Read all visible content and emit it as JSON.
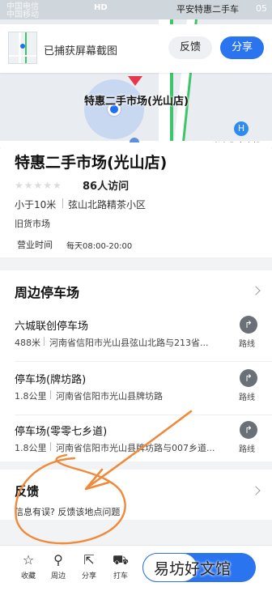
{
  "status_bar": {
    "carrier_line1": "中国电信",
    "carrier_line2": "中国移动",
    "center_text": "HD",
    "time": "05",
    "window_title": "平安特惠二手车"
  },
  "capture": {
    "text": "已捕获屏幕截图",
    "feedback_label": "反馈",
    "share_label": "分享"
  },
  "map": {
    "poi_label": "特惠二手市场(光山店)",
    "hospital_icon": "H",
    "side_label": "光山华康农机"
  },
  "poi": {
    "name": "特惠二手市场(光山店)",
    "stars_icon": "★★★★★",
    "stars_value": 0,
    "visits": "86人访问",
    "distance": "小于10米",
    "address": "弦山北路精茶小区",
    "category": "旧货市场",
    "hours_label": "营业时间",
    "hours": "每天08:00-20:00"
  },
  "parking": {
    "title": "周边停车场",
    "route_label": "路线",
    "items": [
      {
        "name": "六城联创停车场",
        "distance": "488米",
        "address": "河南省信阳市光山县弦山北路与213省..."
      },
      {
        "name": "停车场(牌坊路)",
        "distance": "1.8公里",
        "address": "河南省信阳市光山县牌坊路"
      },
      {
        "name": "停车场(零零七乡道)",
        "distance": "1.8公里",
        "address": "河南省信阳市光山县牌坊路与007乡道..."
      }
    ]
  },
  "feedback": {
    "title": "反馈",
    "subtitle": "信息有误? 反馈该地点问题"
  },
  "tabs": [
    {
      "icon": "star-icon",
      "label": "收藏"
    },
    {
      "icon": "search-icon",
      "label": "周边"
    },
    {
      "icon": "share-icon",
      "label": "分享"
    },
    {
      "icon": "taxi-icon",
      "label": "打车"
    }
  ],
  "watermark": "易坊好文馆",
  "colors": {
    "accent": "#2b74f0",
    "annotation": "#f08a3a",
    "pin": "#e8374a"
  }
}
